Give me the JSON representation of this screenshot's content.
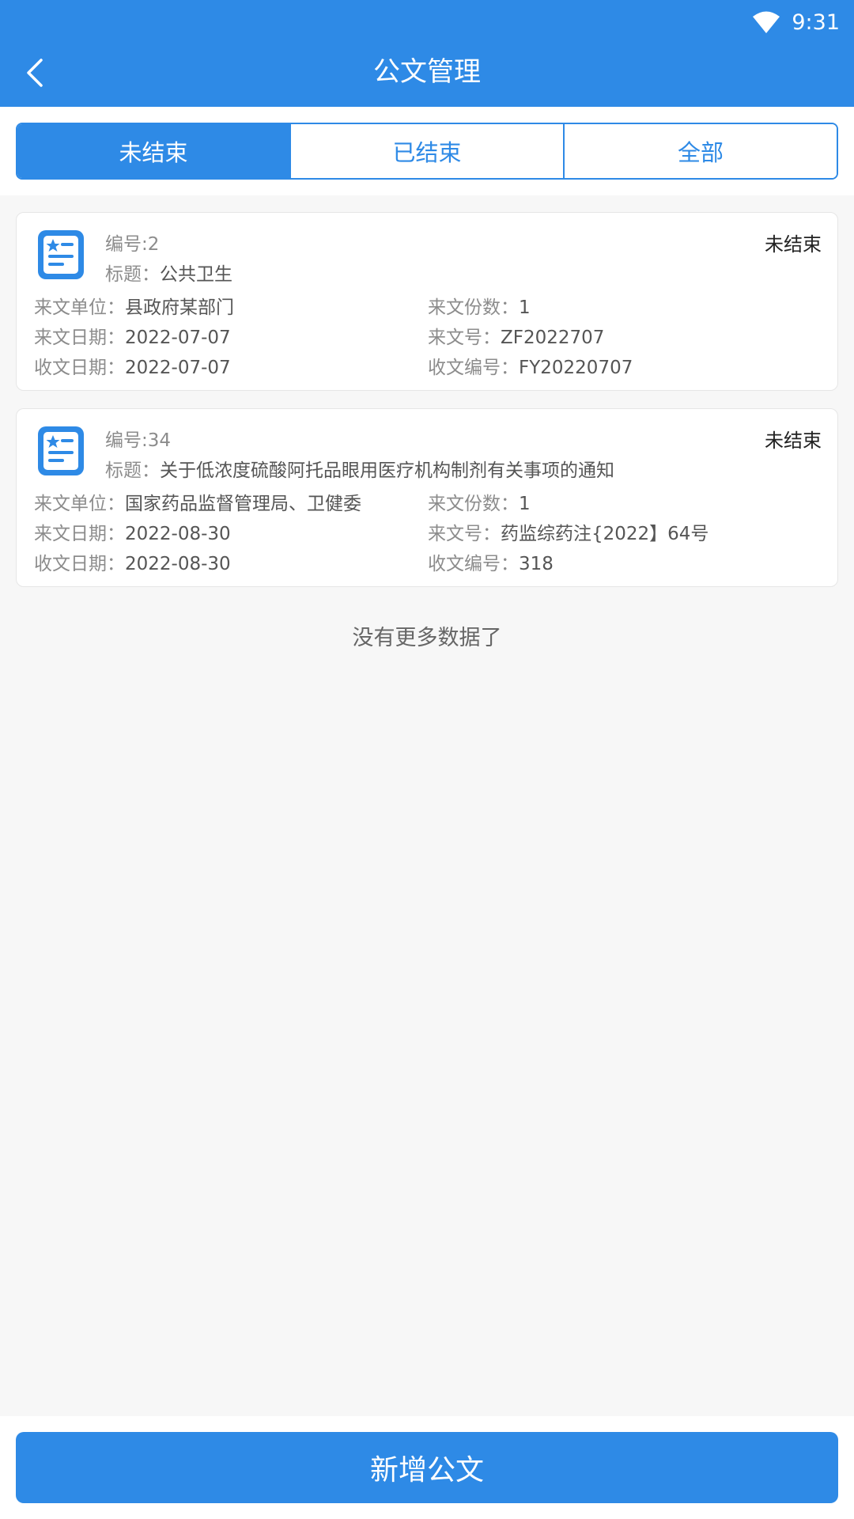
{
  "status_bar": {
    "time": "9:31"
  },
  "header": {
    "title": "公文管理"
  },
  "tabs": [
    {
      "label": "未结束",
      "active": true
    },
    {
      "label": "已结束",
      "active": false
    },
    {
      "label": "全部",
      "active": false
    }
  ],
  "labels": {
    "title": "标题：",
    "unit": "来文单位：",
    "copies": "来文份数：",
    "date": "来文日期：",
    "doc_no": "来文号：",
    "recv_date": "收文日期：",
    "recv_no": "收文编号："
  },
  "documents": [
    {
      "number": "编号:2",
      "status": "未结束",
      "title": "公共卫生",
      "unit": "县政府某部门",
      "copies": "1",
      "date": "2022-07-07",
      "doc_no": "ZF2022707",
      "recv_date": "2022-07-07",
      "recv_no": "FY20220707"
    },
    {
      "number": "编号:34",
      "status": "未结束",
      "title": "关于低浓度硫酸阿托品眼用医疗机构制剂有关事项的通知",
      "unit": "国家药品监督管理局、卫健委",
      "copies": "1",
      "date": "2022-08-30",
      "doc_no": "药监综药注{2022】64号",
      "recv_date": "2022-08-30",
      "recv_no": "318"
    }
  ],
  "footer_text": "没有更多数据了",
  "add_button": "新增公文",
  "colors": {
    "primary": "#2e8ae6",
    "background": "#f7f7f7"
  },
  "icons": [
    "wifi-icon",
    "back-arrow-icon",
    "document-star-icon"
  ]
}
